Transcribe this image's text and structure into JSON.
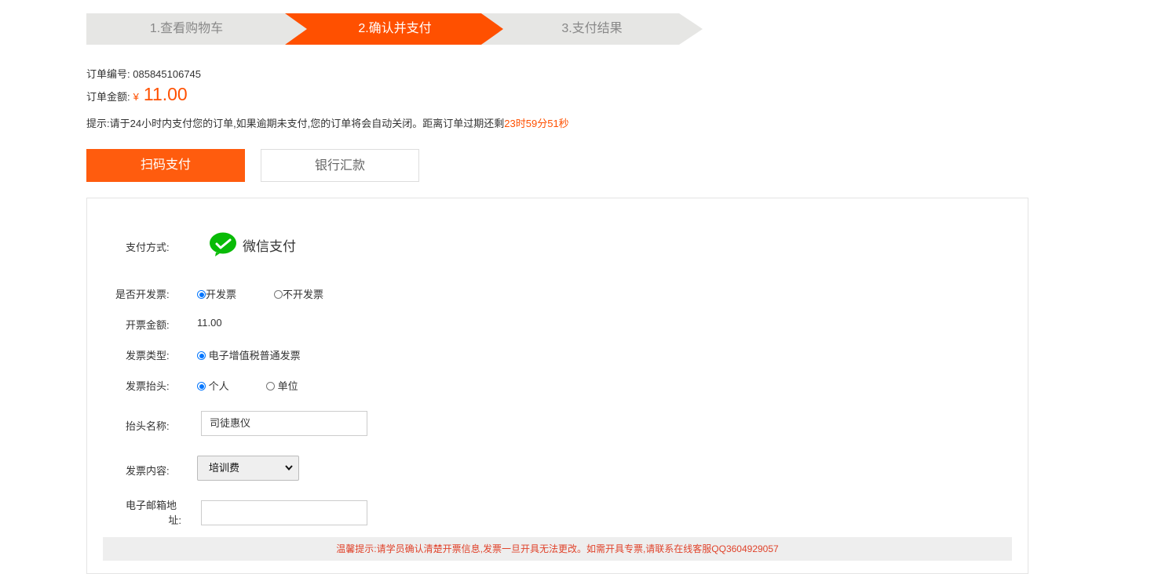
{
  "steps": [
    {
      "label": "1.查看购物车"
    },
    {
      "label": "2.确认并支付"
    },
    {
      "label": "3.支付结果"
    }
  ],
  "order": {
    "number_label": "订单编号:",
    "number": "085845106745",
    "amount_label": "订单金额:",
    "currency": "¥",
    "amount": "11.00",
    "tip_prefix": "提示:请于24小时内支付您的订单,如果逾期未支付,您的订单将会自动关闭。距离订单过期还剩",
    "countdown": "23时59分51秒"
  },
  "tabs": [
    {
      "label": "扫码支付",
      "active": true
    },
    {
      "label": "银行汇款",
      "active": false
    }
  ],
  "form": {
    "payment_label": "支付方式:",
    "payment_method": "微信支付",
    "invoice_label": "是否开发票:",
    "invoice_options": [
      "开发票",
      "不开发票"
    ],
    "invoice_amount_label": "开票金额:",
    "invoice_amount": "11.00",
    "invoice_type_label": "发票类型:",
    "invoice_type": "电子增值税普通发票",
    "invoice_title_label": "发票抬头:",
    "invoice_title_options": [
      "个人",
      "单位"
    ],
    "title_name_label": "抬头名称:",
    "title_name_value": "司徒惠仪",
    "content_label": "发票内容:",
    "content_value": "培训费",
    "email_label_line1": "电子邮箱地",
    "email_label_line2": "址:",
    "email_value": ""
  },
  "notice": "温馨提示:请学员确认清楚开票信息,发票一旦开具无法更改。如需开具专票,请联系在线客服QQ3604929057",
  "colors": {
    "accent": "#ff5000",
    "wechat": "#09bb07",
    "radio": "#0075ff"
  },
  "icons": {
    "wechat": "wechat-pay-icon"
  }
}
